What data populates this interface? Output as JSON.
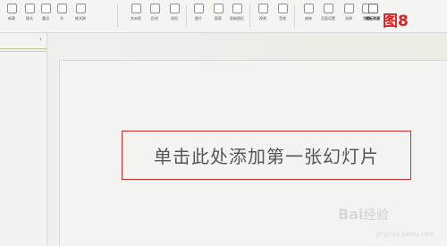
{
  "ribbon": {
    "tools": [
      {
        "name": "new-slide-tool",
        "label": "新建",
        "icon": "new-slide-icon"
      },
      {
        "name": "layout-tool",
        "label": "版式",
        "icon": "layout-icon"
      },
      {
        "name": "reset-tool",
        "label": "重设",
        "icon": "reset-icon"
      },
      {
        "name": "section-tool",
        "label": "节",
        "icon": "section-icon"
      },
      {
        "name": "paste-format-tool",
        "label": "格式刷",
        "icon": "paste-format-icon"
      },
      {
        "name": "text-box-tool",
        "label": "文本框",
        "icon": "text-box-icon"
      },
      {
        "name": "shape-tool",
        "label": "形状",
        "icon": "shape-icon"
      },
      {
        "name": "arrange-tool",
        "label": "排列",
        "icon": "arrange-icon"
      },
      {
        "name": "picture-tool",
        "label": "图片",
        "icon": "picture-icon"
      },
      {
        "name": "chart-tool",
        "label": "图表",
        "icon": "chart-icon"
      },
      {
        "name": "smartart-tool",
        "label": "智能图形",
        "icon": "smartart-icon"
      },
      {
        "name": "video-tool",
        "label": "视频",
        "icon": "video-icon"
      },
      {
        "name": "audio-tool",
        "label": "音频",
        "icon": "audio-icon"
      },
      {
        "name": "slide-show-tool",
        "label": "放映",
        "icon": "slide-show-icon"
      },
      {
        "name": "page-setup-tool",
        "label": "页面设置",
        "icon": "page-setup-icon"
      },
      {
        "name": "select-tool",
        "label": "选择",
        "icon": "select-icon"
      },
      {
        "name": "replace-tool",
        "label": "替换",
        "icon": "replace-icon"
      },
      {
        "name": "template-tool",
        "label": "模板资源",
        "icon": "template-icon"
      }
    ],
    "figure_label": "图8"
  },
  "slide": {
    "title_placeholder": "单击此处添加第一张幻灯片"
  },
  "watermark": {
    "brand": "Bai",
    "suffix": "经验",
    "sub": "jingyan.baidu.com"
  },
  "colors": {
    "highlight": "#cf2b2b",
    "figure_label": "#e02020"
  }
}
